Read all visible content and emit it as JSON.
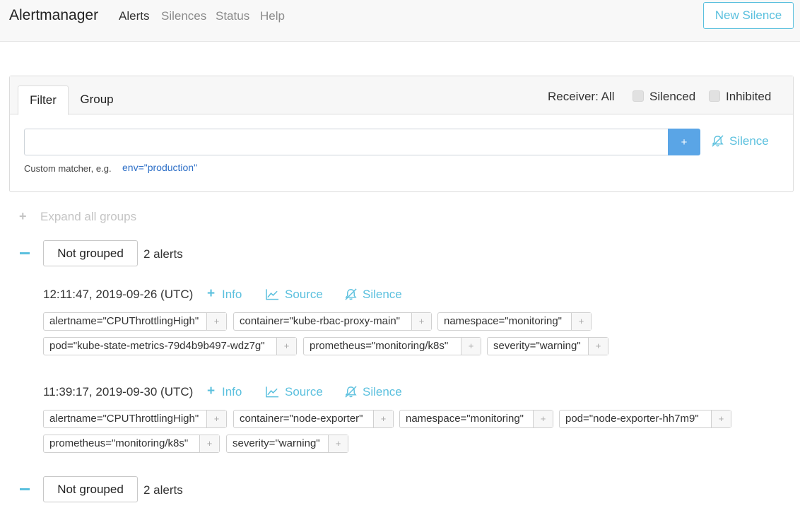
{
  "nav": {
    "brand": "Alertmanager",
    "links": [
      "Alerts",
      "Silences",
      "Status",
      "Help"
    ],
    "new_silence": "New Silence"
  },
  "filter_card": {
    "tabs": [
      "Filter",
      "Group"
    ],
    "receiver": "Receiver: All",
    "silenced": "Silenced",
    "inhibited": "Inhibited",
    "input_value": "",
    "add_button": "+",
    "silence_link": "Silence",
    "hint_prefix": "Custom matcher, e.g.",
    "hint_example": "env=\"production\""
  },
  "expand_all": "Expand all groups",
  "groups": [
    {
      "label": "Not grouped",
      "count": "2 alerts",
      "alerts": [
        {
          "time": "12:11:47, 2019-09-26 (UTC)",
          "actions": [
            "Info",
            "Source",
            "Silence"
          ],
          "labels": [
            "alertname=\"CPUThrottlingHigh\"",
            "container=\"kube-rbac-proxy-main\"",
            "namespace=\"monitoring\"",
            "pod=\"kube-state-metrics-79d4b9b497-wdz7g\"",
            "prometheus=\"monitoring/k8s\"",
            "severity=\"warning\""
          ]
        },
        {
          "time": "11:39:17, 2019-09-30 (UTC)",
          "actions": [
            "Info",
            "Source",
            "Silence"
          ],
          "labels": [
            "alertname=\"CPUThrottlingHigh\"",
            "container=\"node-exporter\"",
            "namespace=\"monitoring\"",
            "pod=\"node-exporter-hh7m9\"",
            "prometheus=\"monitoring/k8s\"",
            "severity=\"warning\""
          ]
        }
      ]
    },
    {
      "label": "Not grouped",
      "count": "2 alerts",
      "alerts": []
    }
  ],
  "label_add": "+",
  "colors": {
    "accent": "#5bc0de",
    "primary_button": "#5aa5e6",
    "link": "#2d6fc7"
  }
}
